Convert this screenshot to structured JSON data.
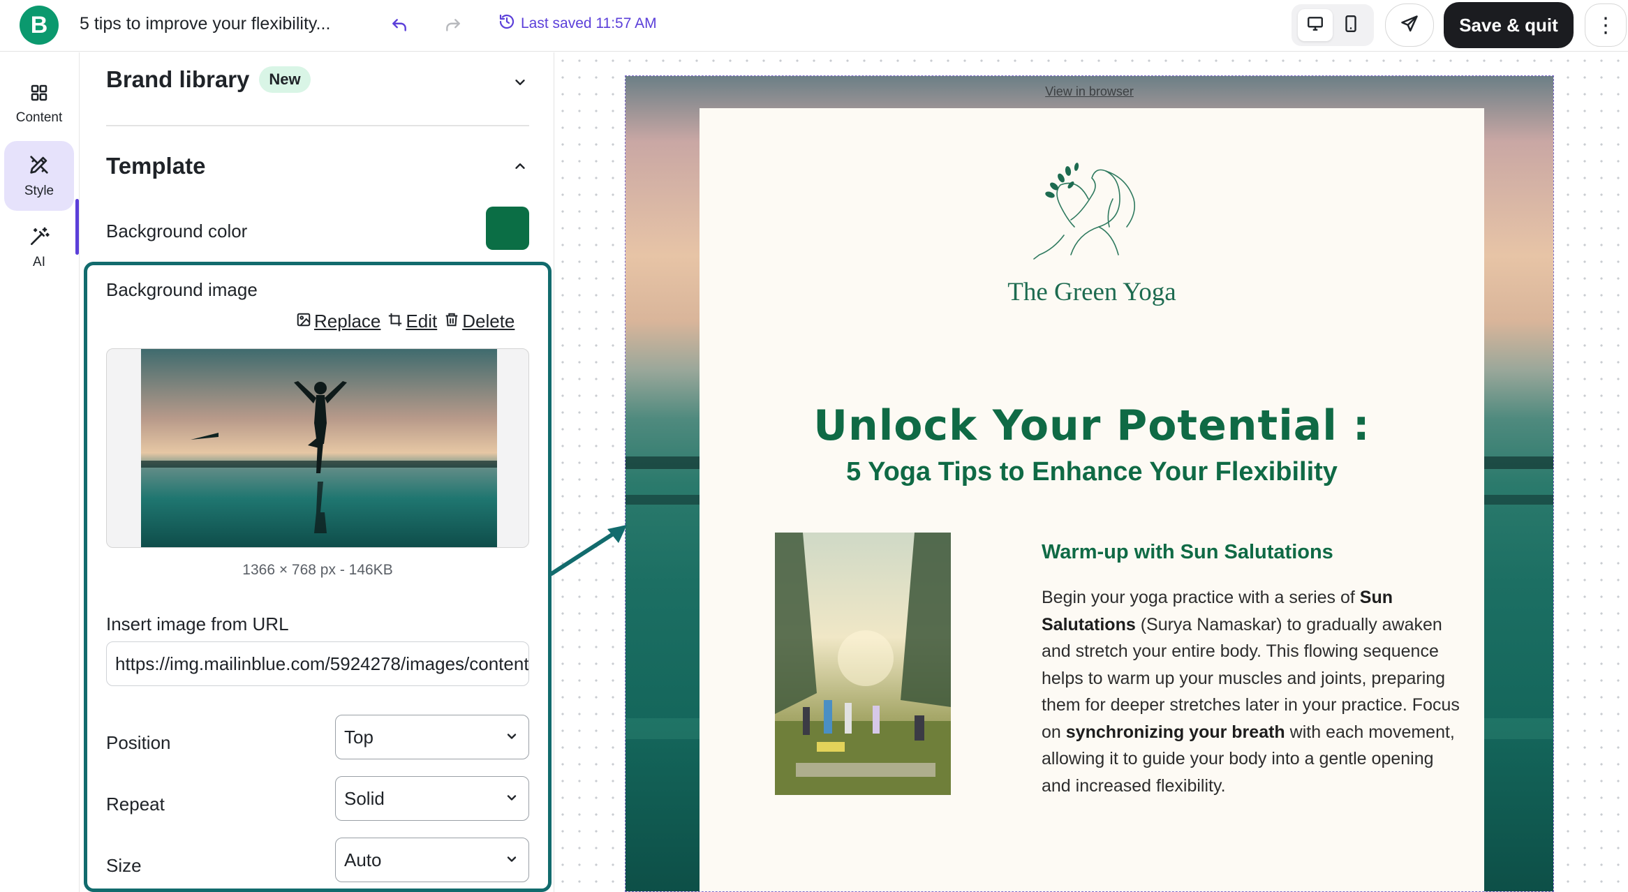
{
  "app": {
    "logo_letter": "B",
    "doc_title": "5 tips to improve your flexibility...",
    "last_saved": "Last saved 11:57 AM",
    "save_quit": "Save & quit",
    "more": "⋮"
  },
  "rail": {
    "items": [
      {
        "label": "Content",
        "icon": "grid-icon"
      },
      {
        "label": "Style",
        "icon": "pen-ruler-icon"
      },
      {
        "label": "AI",
        "icon": "magic-wand-icon"
      }
    ]
  },
  "panel": {
    "brand_library": "Brand library",
    "brand_badge": "New",
    "template": "Template",
    "background_color_label": "Background color",
    "background_color_value": "#0b6e45",
    "background_image_label": "Background image",
    "replace": "Replace",
    "edit": "Edit",
    "delete": "Delete",
    "image_meta": "1366 × 768 px - 146KB",
    "insert_url_label": "Insert image from URL",
    "url_value": "https://img.mailinblue.com/5924278/images/content_library/original",
    "position_label": "Position",
    "position_value": "Top",
    "repeat_label": "Repeat",
    "repeat_value": "Solid",
    "size_label": "Size",
    "size_value": "Auto"
  },
  "email": {
    "view_in_browser": "View in browser",
    "brand_name": "The Green Yoga",
    "headline": "Unlock Your Potential :",
    "subheadline": "5 Yoga Tips to Enhance Your Flexibility",
    "section_title": "Warm-up with Sun Salutations",
    "para_1": "Begin your yoga practice with a series of ",
    "para_bold_1": "Sun Salutations",
    "para_2": " (Surya Namaskar) to gradually awaken and stretch your entire body. This flowing sequence helps to warm up your muscles and joints, preparing them for deeper stretches later in your practice. Focus on ",
    "para_bold_2": "synchronizing your breath",
    "para_3": " with each movement, allowing it to guide your body into a gentle opening and increased flexibility."
  },
  "colors": {
    "brand_green": "#0b996e",
    "accent_purple": "#5b3fd9",
    "panel_highlight": "#126b6d",
    "headline_green": "#0f6a45"
  }
}
